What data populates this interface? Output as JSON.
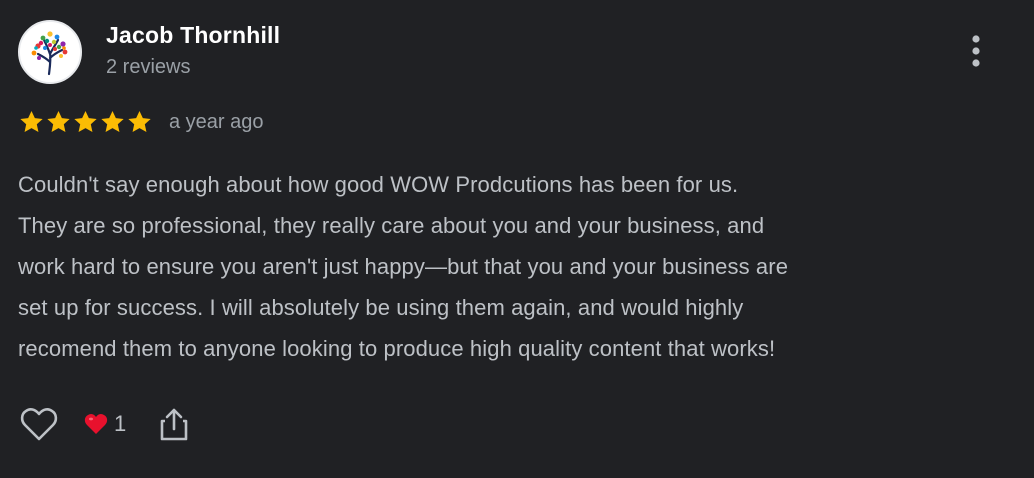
{
  "review": {
    "reviewer": {
      "name": "Jacob Thornhill",
      "review_count": "2 reviews",
      "avatar_icon": "tree-logo-icon"
    },
    "rating": {
      "stars": 5,
      "max": 5,
      "star_color": "#fbbc04"
    },
    "date": "a year ago",
    "text_lines": [
      "Couldn't say enough about how good WOW Prodcutions has been for us.",
      "They are so professional, they really care about you and your business, and",
      "work hard to ensure you aren't just happy—but that you and your business are",
      "set up for success. I will absolutely be using them again, and would highly",
      "recomend them to anyone looking to produce high quality content that works!"
    ],
    "actions": {
      "like_icon": "heart-outline-icon",
      "reaction_icon": "red-heart-icon",
      "reaction_count": "1",
      "share_icon": "share-icon",
      "more_icon": "more-vert-icon"
    }
  },
  "colors": {
    "background": "#202124",
    "name": "#ffffff",
    "secondary_text": "#9aa0a6",
    "body_text": "#bdc1c6",
    "heart": "#e8112d"
  }
}
